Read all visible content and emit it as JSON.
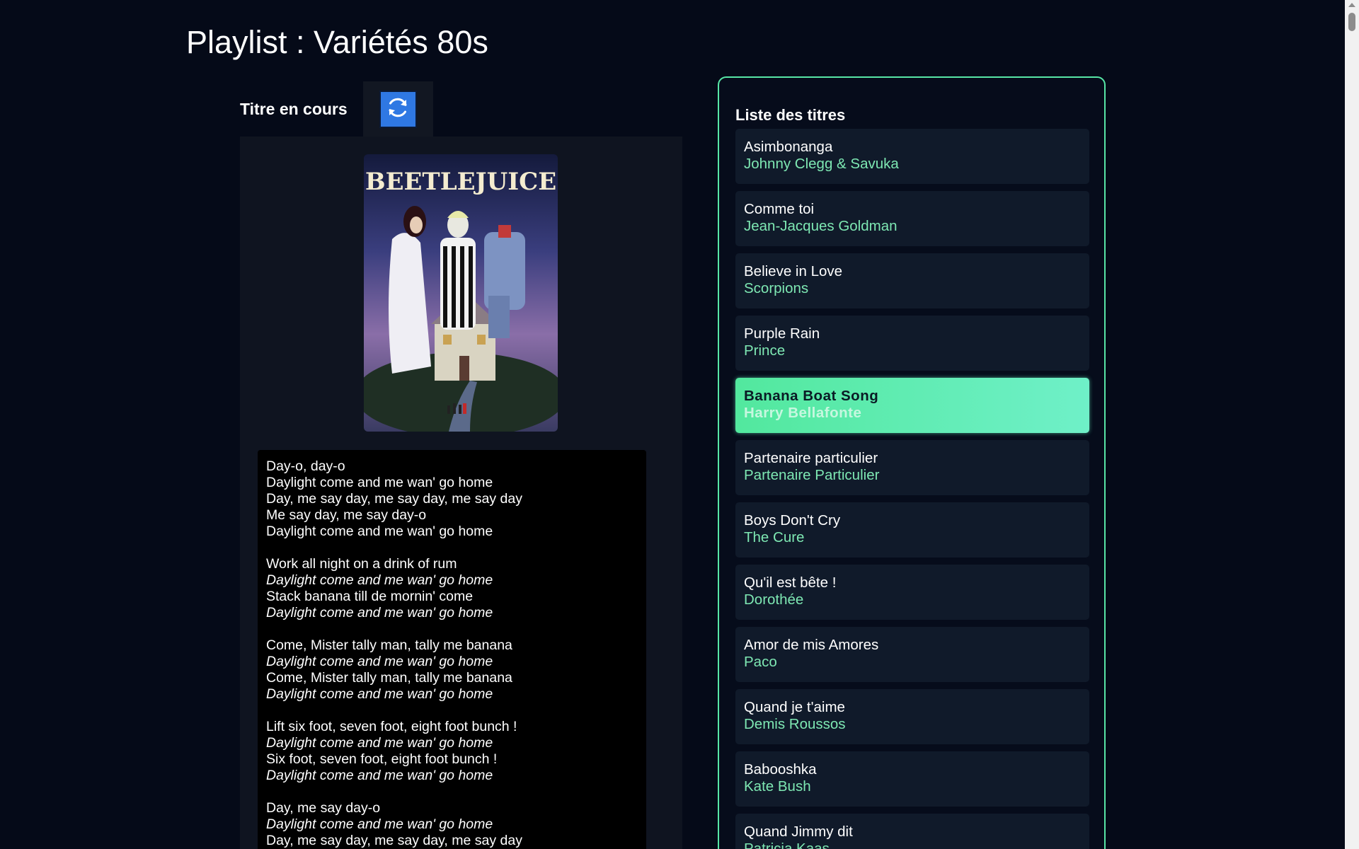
{
  "page": {
    "title": "Playlist : Variétés 80s"
  },
  "now_playing": {
    "label": "Titre en cours",
    "refresh_icon": "refresh-icon",
    "poster_text": "BEETLEJUICE",
    "lyrics": [
      {
        "text": "Day-o, day-o",
        "style": "normal"
      },
      {
        "text": "Daylight come and me wan' go home",
        "style": "normal"
      },
      {
        "text": "Day, me say day, me say day, me say day",
        "style": "normal"
      },
      {
        "text": "Me say day, me say day-o",
        "style": "normal"
      },
      {
        "text": "Daylight come and me wan' go home",
        "style": "normal"
      },
      {
        "text": "",
        "style": "gap"
      },
      {
        "text": "Work all night on a drink of rum",
        "style": "normal"
      },
      {
        "text": "Daylight come and me wan' go home",
        "style": "chorus"
      },
      {
        "text": "Stack banana till de mornin' come",
        "style": "normal"
      },
      {
        "text": "Daylight come and me wan' go home",
        "style": "chorus"
      },
      {
        "text": "",
        "style": "gap"
      },
      {
        "text": "Come, Mister tally man, tally me banana",
        "style": "normal"
      },
      {
        "text": "Daylight come and me wan' go home",
        "style": "chorus"
      },
      {
        "text": "Come, Mister tally man, tally me banana",
        "style": "normal"
      },
      {
        "text": "Daylight come and me wan' go home",
        "style": "chorus"
      },
      {
        "text": "",
        "style": "gap"
      },
      {
        "text": "Lift six foot, seven foot, eight foot bunch !",
        "style": "normal"
      },
      {
        "text": "Daylight come and me wan' go home",
        "style": "chorus"
      },
      {
        "text": "Six foot, seven foot, eight foot bunch !",
        "style": "normal"
      },
      {
        "text": "Daylight come and me wan' go home",
        "style": "chorus"
      },
      {
        "text": "",
        "style": "gap"
      },
      {
        "text": "Day, me say day-o",
        "style": "normal"
      },
      {
        "text": "Daylight come and me wan' go home",
        "style": "chorus"
      },
      {
        "text": "Day, me say day, me say day, me say day",
        "style": "normal"
      }
    ]
  },
  "playlist": {
    "title": "Liste des titres",
    "active_index": 4,
    "tracks": [
      {
        "title": "Asimbonanga",
        "artist": "Johnny Clegg & Savuka"
      },
      {
        "title": "Comme toi",
        "artist": "Jean-Jacques Goldman"
      },
      {
        "title": "Believe in Love",
        "artist": "Scorpions"
      },
      {
        "title": "Purple Rain",
        "artist": "Prince"
      },
      {
        "title": "Banana Boat Song",
        "artist": "Harry Bellafonte"
      },
      {
        "title": "Partenaire particulier",
        "artist": "Partenaire Particulier"
      },
      {
        "title": "Boys Don't Cry",
        "artist": "The Cure"
      },
      {
        "title": "Qu'il est bête !",
        "artist": "Dorothée"
      },
      {
        "title": "Amor de mis Amores",
        "artist": "Paco"
      },
      {
        "title": "Quand je t'aime",
        "artist": "Demis Roussos"
      },
      {
        "title": "Babooshka",
        "artist": "Kate Bush"
      },
      {
        "title": "Quand Jimmy dit",
        "artist": "Patricia Kaas"
      }
    ]
  },
  "colors": {
    "background": "#050a18",
    "accent": "#57e6a6",
    "artist_text": "#7ee8b3",
    "refresh_button": "#2f78e3"
  }
}
